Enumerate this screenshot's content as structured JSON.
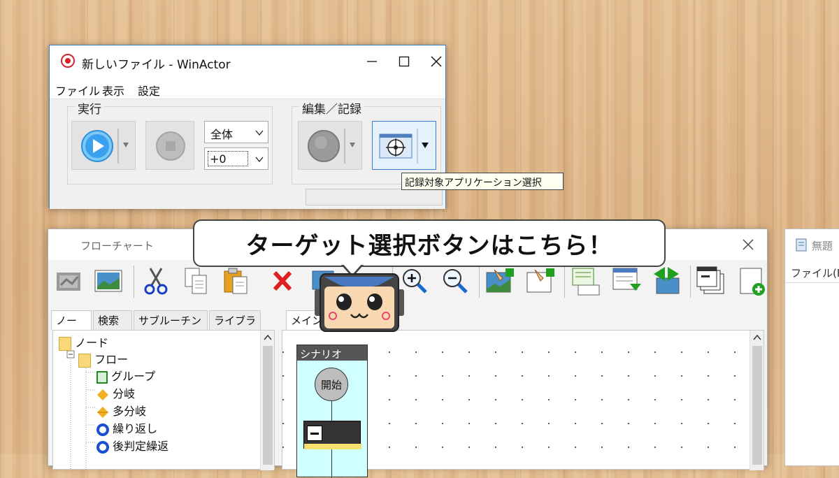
{
  "winactor": {
    "title": "新しいファイル - WinActor",
    "menu": [
      "ファイル",
      "表示",
      "設定"
    ],
    "run_group_label": "実行",
    "scope_select": "全体",
    "offset_select": "+0",
    "edit_group_label": "編集／記録",
    "tooltip": "記録対象アプリケーション選択"
  },
  "flowchart": {
    "title": "フローチャート",
    "tabs": [
      "ノード",
      "検索",
      "サブルーチン",
      "ライブラリ"
    ],
    "tree": [
      "ノード",
      "フロー",
      "グループ",
      "分岐",
      "多分岐",
      "繰り返し",
      "後判定繰返"
    ],
    "main_tab": "メイン",
    "scenario_label": "シナリオ",
    "start_label": "開始"
  },
  "third_window": {
    "title": "無題",
    "menu": "ファイル(F)"
  },
  "callout": {
    "text": "ターゲット選択ボタンはこちら！"
  },
  "colors": {
    "accent_blue": "#3d7ed0",
    "play_blue": "#3aa0f0",
    "delete_red": "#e02020",
    "highlight_border": "#3c78d8"
  }
}
